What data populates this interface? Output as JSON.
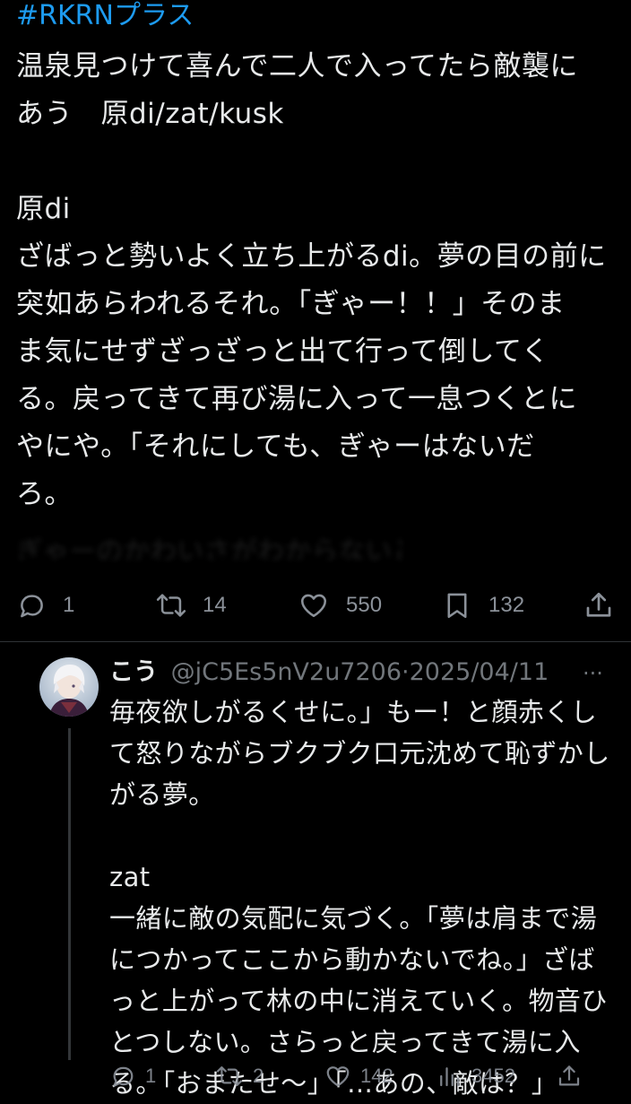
{
  "tweet": {
    "hashtag": "#RKRNプラス",
    "body": "温泉見つけて喜んで二人で入ってたら敵襲に\nあう　原di/zat/kusk\n\n原di\nざばっと勢いよく立ち上がるdi。夢の目の前に\n突如あらわれるそれ。「ぎゃー！！」そのま\nま気にせずざっざっと出て行って倒してく\nる。戻ってきて再び湯に入って一息つくとに\nやにや。「それにしても、ぎゃーはないだ\nろ。",
    "faded_line": "ぎゃーのかわいさがわからないとはね",
    "actions": {
      "reply_count": "1",
      "repost_count": "14",
      "like_count": "550",
      "bookmark_count": "132"
    }
  },
  "reply": {
    "name": "こう",
    "handle": "@jC5Es5nV2u7206",
    "date": "2025/04/11",
    "more": "···",
    "body": "毎夜欲しがるくせに。」もー！と顔赤くし\nて怒りながらブクブク口元沈めて恥ずかし\nがる夢。\n\nzat\n一緒に敵の気配に気づく。「夢は肩まで湯\nにつかってここから動かないでね。」ざば\nっと上がって林の中に消えていく。物音ひ\nとつしない。さらっと戻ってきて湯に入\nる。「おまたせ〜」「…あの、敵は？」",
    "actions": {
      "reply_count": "1",
      "repost_count": "2",
      "like_count": "142",
      "views_count": "3452"
    }
  },
  "icons": {
    "reply": "reply-icon",
    "repost": "repost-icon",
    "like": "heart-icon",
    "bookmark": "bookmark-icon",
    "share": "share-icon",
    "views": "views-icon",
    "more": "more-icon"
  },
  "colors": {
    "background": "#000000",
    "text": "#e7e9ea",
    "muted": "#71767b",
    "accent": "#1d9bf0"
  }
}
